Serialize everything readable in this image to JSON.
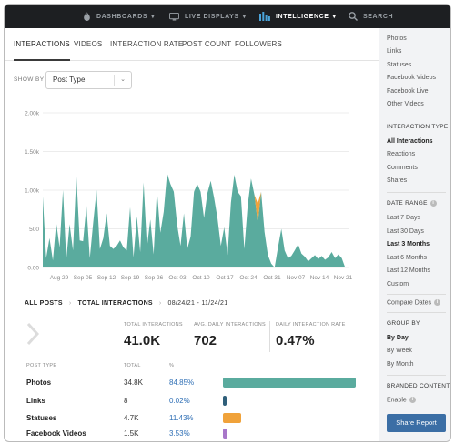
{
  "nav": {
    "dashboards": "DASHBOARDS",
    "live_displays": "LIVE DISPLAYS",
    "intelligence": "INTELLIGENCE",
    "search": "SEARCH"
  },
  "tabs": [
    "INTERACTIONS",
    "VIDEOS",
    "INTERACTION RATE",
    "POST COUNT",
    "FOLLOWERS"
  ],
  "show_by": {
    "label": "SHOW BY",
    "value": "Post Type"
  },
  "chart_data": {
    "type": "area",
    "stacked": true,
    "y_ticks": [
      "0.00",
      "500",
      "1.00k",
      "1.50k",
      "2.00k"
    ],
    "ylim": [
      0,
      2000
    ],
    "x_ticks": [
      "Aug 29",
      "Sep 05",
      "Sep 12",
      "Sep 19",
      "Sep 26",
      "Oct 03",
      "Oct 10",
      "Oct 17",
      "Oct 24",
      "Oct 31",
      "Nov 07",
      "Nov 14",
      "Nov 21"
    ],
    "colors": {
      "Photos": "#5aab9e",
      "Links": "#2f5f7a",
      "Statuses": "#f0a23a",
      "Facebook Videos": "#a877c9"
    },
    "series": [
      {
        "name": "Photos",
        "values": [
          920,
          120,
          380,
          90,
          580,
          260,
          1000,
          100,
          560,
          220,
          1200,
          350,
          340,
          800,
          120,
          580,
          1000,
          240,
          380,
          700,
          280,
          240,
          280,
          350,
          260,
          220,
          780,
          130,
          660,
          200,
          1100,
          260,
          620,
          170,
          1000,
          450,
          720,
          1220,
          1080,
          980,
          550,
          280,
          700,
          240,
          400,
          980,
          1080,
          980,
          640,
          960,
          1120,
          900,
          640,
          280,
          520,
          160,
          840,
          1200,
          980,
          920,
          240,
          800,
          1150,
          940,
          580,
          980,
          460,
          160,
          50,
          0,
          260,
          500,
          220,
          120,
          150,
          220,
          300,
          180,
          140,
          80,
          120,
          160,
          110,
          150,
          100,
          130,
          200,
          120,
          170,
          120,
          0,
          0
        ]
      },
      {
        "name": "Statuses",
        "values": [
          0,
          0,
          0,
          0,
          0,
          0,
          0,
          0,
          0,
          0,
          0,
          0,
          0,
          0,
          0,
          0,
          0,
          0,
          0,
          0,
          0,
          0,
          0,
          0,
          0,
          0,
          0,
          0,
          0,
          0,
          0,
          0,
          0,
          0,
          0,
          0,
          0,
          0,
          0,
          0,
          0,
          0,
          0,
          0,
          0,
          0,
          0,
          0,
          0,
          0,
          0,
          0,
          0,
          0,
          0,
          0,
          0,
          0,
          0,
          0,
          0,
          0,
          0,
          0,
          250,
          0,
          0,
          0,
          0,
          0,
          0,
          0,
          0,
          0,
          0,
          0,
          0,
          0,
          0,
          0,
          0,
          0,
          0,
          0,
          0,
          0,
          0,
          0,
          0,
          0,
          0,
          0,
          0
        ]
      },
      {
        "name": "Facebook Videos",
        "values": [
          0,
          0,
          0,
          0,
          0,
          0,
          0,
          0,
          0,
          0,
          0,
          0,
          0,
          0,
          0,
          0,
          0,
          0,
          0,
          0,
          0,
          0,
          0,
          0,
          0,
          0,
          0,
          0,
          0,
          0,
          0,
          0,
          0,
          0,
          0,
          0,
          0,
          0,
          0,
          0,
          0,
          0,
          0,
          0,
          0,
          0,
          0,
          0,
          0,
          0,
          0,
          0,
          0,
          0,
          0,
          0,
          0,
          0,
          0,
          0,
          0,
          0,
          0,
          0,
          0,
          0,
          0,
          0,
          0,
          0,
          0,
          0,
          0,
          0,
          0,
          0,
          0,
          0,
          0,
          0,
          0,
          0,
          0,
          0,
          0,
          0,
          0,
          0,
          0,
          0,
          0,
          0,
          0
        ]
      }
    ]
  },
  "summary": {
    "crumb_all": "ALL POSTS",
    "crumb_metric": "TOTAL INTERACTIONS",
    "crumb_range": "08/24/21 - 11/24/21",
    "stats": [
      {
        "label": "TOTAL INTERACTIONS",
        "value": "41.0K"
      },
      {
        "label": "AVG. DAILY INTERACTIONS",
        "value": "702"
      },
      {
        "label": "DAILY INTERACTION RATE",
        "value": "0.47%"
      }
    ],
    "table_headers": {
      "type": "POST TYPE",
      "total": "TOTAL",
      "pct": "%"
    },
    "rows": [
      {
        "name": "Photos",
        "total": "34.8K",
        "pct": "84.85%",
        "share": 0.8485,
        "color": "#5aab9e"
      },
      {
        "name": "Links",
        "total": "8",
        "pct": "0.02%",
        "share": 0.0002,
        "color": "#2f5f7a"
      },
      {
        "name": "Statuses",
        "total": "4.7K",
        "pct": "11.43%",
        "share": 0.1143,
        "color": "#f0a23a"
      },
      {
        "name": "Facebook Videos",
        "total": "1.5K",
        "pct": "3.53%",
        "share": 0.0353,
        "color": "#a877c9"
      }
    ]
  },
  "panel": {
    "top_items": [
      "Photos",
      "Links",
      "Statuses",
      "Facebook Videos",
      "Facebook Live",
      "Other Videos"
    ],
    "interaction_type": {
      "heading": "INTERACTION TYPE",
      "items": [
        "All Interactions",
        "Reactions",
        "Comments",
        "Shares"
      ],
      "selected": "All Interactions"
    },
    "date_range": {
      "heading": "DATE RANGE",
      "items": [
        "Last 7 Days",
        "Last 30 Days",
        "Last 3 Months",
        "Last 6 Months",
        "Last 12 Months",
        "Custom"
      ],
      "selected": "Last 3 Months"
    },
    "compare": "Compare Dates",
    "group_by": {
      "heading": "GROUP BY",
      "items": [
        "By Day",
        "By Week",
        "By Month"
      ],
      "selected": "By Day"
    },
    "branded": {
      "heading": "BRANDED CONTENT",
      "enable": "Enable"
    },
    "share_button": "Share Report"
  }
}
